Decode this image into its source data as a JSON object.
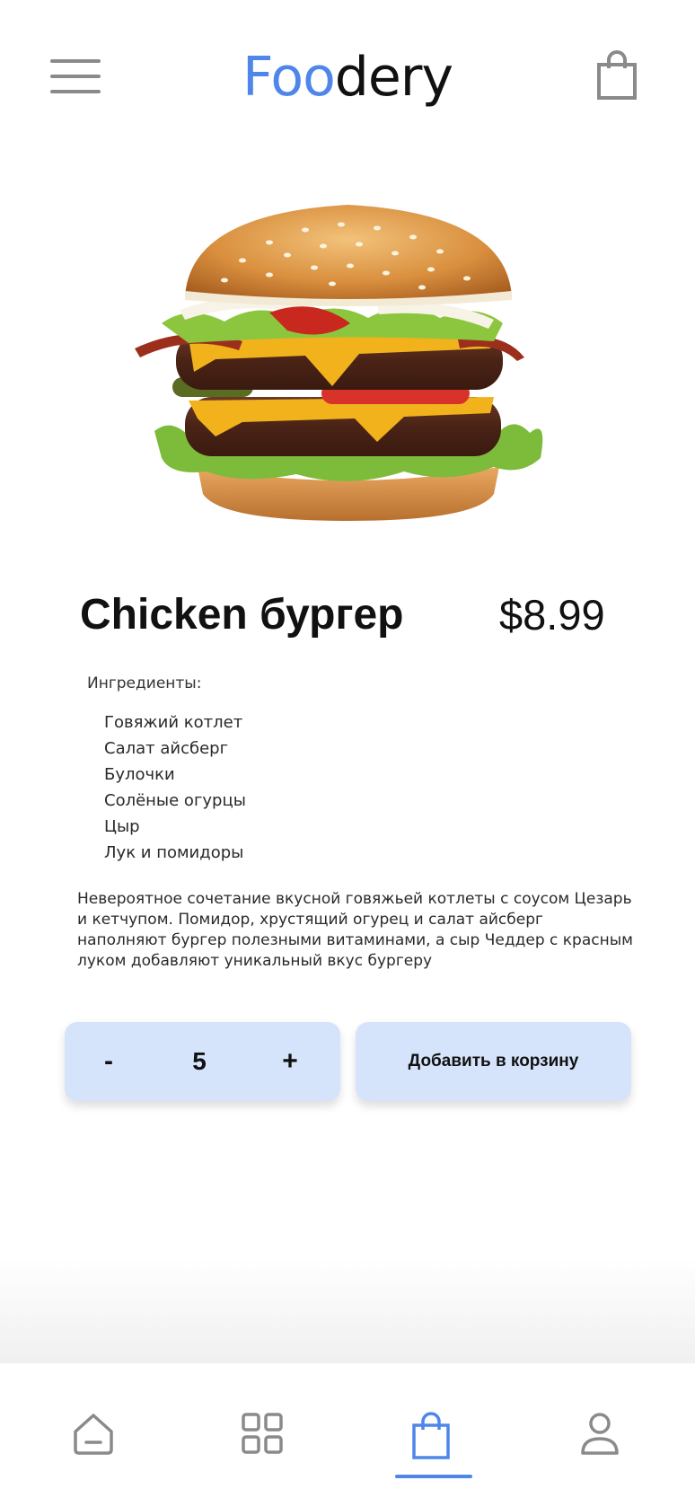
{
  "colors": {
    "accent": "#4f86ea",
    "button_background": "#d6e4fb",
    "icon_gray": "#8a8a8a"
  },
  "header": {
    "logo_part1": "Foo",
    "logo_part2": "dery",
    "menu_icon": "hamburger-menu-icon",
    "cart_icon": "shopping-bag-icon"
  },
  "product": {
    "title": "Chicken бургер",
    "price": "$8.99",
    "image_alt": "burger"
  },
  "ingredients": {
    "heading": "Ингредиенты:",
    "items": [
      "Говяжий котлет",
      "Салат айсберг",
      "Булочки",
      "Солёные огурцы",
      "Цыр",
      "Лук и помидоры"
    ]
  },
  "description": "Невероятное сочетание вкусной говяжьей котлеты с соусом Цезарь и  кетчупом. Помидор, хрустящий огурец и салат айсберг наполняют бургер  полезными витаминами, а сыр Чеддер с красным луком добавляют уникальный  вкус бургеру",
  "stepper": {
    "minus": "-",
    "quantity": "5",
    "plus": "+"
  },
  "add_to_cart": "Добавить в корзину",
  "bottom_nav": {
    "items": [
      {
        "icon": "home-icon",
        "active": false
      },
      {
        "icon": "grid-icon",
        "active": false
      },
      {
        "icon": "shopping-bag-icon",
        "active": true
      },
      {
        "icon": "user-icon",
        "active": false
      }
    ]
  }
}
